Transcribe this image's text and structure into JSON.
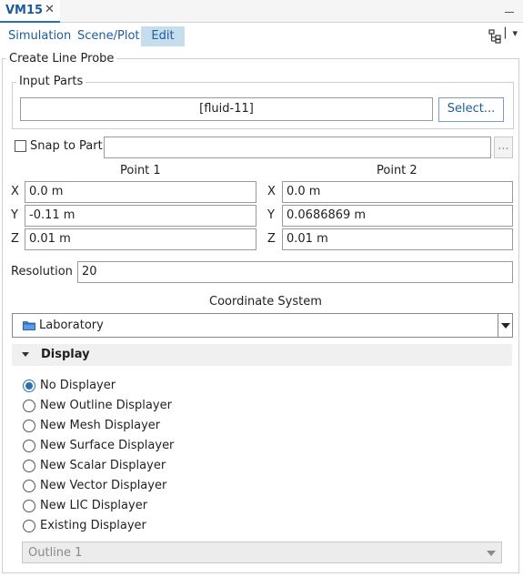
{
  "tab": {
    "title": "VM15",
    "close": "✕"
  },
  "menu": {
    "items": [
      "Simulation",
      "Scene/Plot",
      "Edit"
    ],
    "active_index": 2
  },
  "panel": {
    "title": "Create Line Probe",
    "input_parts": {
      "label": "Input Parts",
      "value": "[fluid-11]",
      "select_button": "Select..."
    },
    "snap": {
      "label": "Snap to Part",
      "checked": false,
      "value": "",
      "browse_button": "..."
    },
    "point1": {
      "title": "Point 1",
      "x_label": "X",
      "y_label": "Y",
      "z_label": "Z",
      "x": "0.0 m",
      "y": "-0.11 m",
      "z": "0.01 m"
    },
    "point2": {
      "title": "Point 2",
      "x_label": "X",
      "y_label": "Y",
      "z_label": "Z",
      "x": "0.0 m",
      "y": "0.0686869 m",
      "z": "0.01 m"
    },
    "resolution": {
      "label": "Resolution",
      "value": "20"
    },
    "coord": {
      "label": "Coordinate System",
      "value": "Laboratory",
      "icon": "folder-icon"
    },
    "display": {
      "title": "Display",
      "options": [
        "No Displayer",
        "New Outline Displayer",
        "New Mesh Displayer",
        "New Surface Displayer",
        "New Scalar Displayer",
        "New Vector Displayer",
        "New LIC Displayer",
        "Existing Displayer"
      ],
      "selected_index": 0,
      "existing_value": "Outline 1"
    }
  },
  "colors": {
    "accent": "#1c5c9e",
    "active_menu_bg": "#c6dded",
    "section_bg": "#f0f0f0"
  }
}
